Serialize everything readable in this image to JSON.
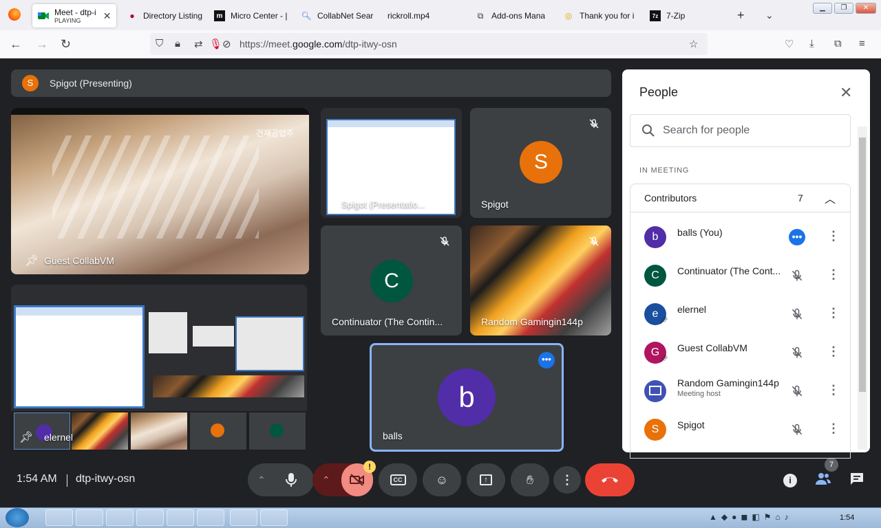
{
  "browser": {
    "tabs": [
      {
        "label": "Meet - dtp-i",
        "sub": "PLAYING",
        "active": true
      },
      {
        "label": "Directory Listing"
      },
      {
        "label": "Micro Center - |"
      },
      {
        "label": "CollabNet Sear"
      },
      {
        "label": "rickroll.mp4"
      },
      {
        "label": "Add-ons Mana"
      },
      {
        "label": "Thank you for i"
      },
      {
        "label": "7-Zip"
      }
    ],
    "url_prefix": "https://meet.",
    "url_domain": "google.com",
    "url_path": "/dtp-itwy-osn"
  },
  "meet": {
    "presenting_initial": "S",
    "presenting_label": "Spigot (Presenting)",
    "tiles": {
      "guest_name": "Guest CollabVM",
      "video_overlay_text": "건재공업주",
      "spigot_pres_name": "Spigot (Presentatio...",
      "spigot_initial": "S",
      "spigot_name": "Spigot",
      "continuator_initial": "C",
      "continuator_name": "Continuator (The Contin...",
      "random_name": "Random Gamingin144p",
      "elernel_name": "elernel",
      "balls_initial": "b",
      "balls_name": "balls"
    },
    "time": "1:54 AM",
    "meeting_code": "dtp-itwy-osn",
    "people_count_badge": "7",
    "cam_warning": "!"
  },
  "people": {
    "title": "People",
    "search_placeholder": "Search for people",
    "section_label": "IN MEETING",
    "group_label": "Contributors",
    "group_count": "7",
    "participants": [
      {
        "initial": "b",
        "name": "balls (You)",
        "color": "#512da8"
      },
      {
        "initial": "C",
        "name": "Continuator (The Cont...",
        "color": "#00563f"
      },
      {
        "initial": "e",
        "name": "elernel",
        "color": "#1a4fa0"
      },
      {
        "initial": "G",
        "name": "Guest CollabVM",
        "color": "#b0155f"
      },
      {
        "initial": "",
        "name": "Random Gamingin144p",
        "sub": "Meeting host",
        "color": "#3f51b5"
      },
      {
        "initial": "S",
        "name": "Spigot",
        "color": "#e8710a"
      }
    ]
  },
  "taskbar": {
    "clock": "1:54"
  }
}
